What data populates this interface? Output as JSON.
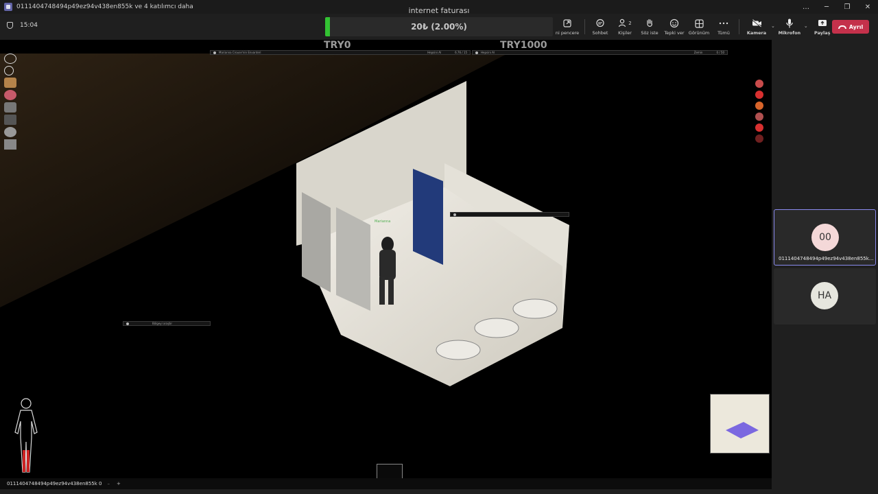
{
  "titlebar": {
    "title": "0111404748494p49ez94v438en855k ve 4 katılımcı daha",
    "controls": [
      "…",
      "─",
      "❐",
      "✕"
    ]
  },
  "stream": {
    "title": "internet faturası",
    "progress_label": "20₺ (2.00%)",
    "progress_fraction": 0.02,
    "left_label": "TRY0",
    "right_label": "TRY1000"
  },
  "meeting": {
    "timer": "15:04",
    "tools": [
      {
        "label": "ni pencere",
        "icon": "popout-icon"
      },
      {
        "label": "Sohbet",
        "icon": "chat-icon"
      },
      {
        "label": "Kişiler",
        "icon": "people-icon",
        "count": "2"
      },
      {
        "label": "Söz iste",
        "icon": "raise-hand-icon"
      },
      {
        "label": "Tepki ver",
        "icon": "emoji-icon"
      },
      {
        "label": "Görünüm",
        "icon": "view-icon"
      },
      {
        "label": "Tümü",
        "icon": "more-icon"
      },
      {
        "label": "Kamera",
        "icon": "camera-off-icon"
      },
      {
        "label": "Mikrofon",
        "icon": "mic-icon"
      },
      {
        "label": "Paylaş",
        "icon": "share-icon"
      }
    ],
    "leave_label": "Ayrıl",
    "leave_color": "#c4314b"
  },
  "game": {
    "inventory_left": {
      "title": "Marianna Crouse'nin Envanteri",
      "action": "Hepsini Al",
      "weight": "6.76 / 15"
    },
    "inventory_right": {
      "title": "Hepsini Al",
      "action": "Zemin",
      "weight": "0 / 50"
    },
    "search_bar": "Bölgeyi araştır",
    "player_name_tag": "Marianna"
  },
  "participants": [
    {
      "initials": "00",
      "name": "0111404748494p49ez94v438en855k...",
      "avatar_bg": "#f4d8d8",
      "active": true
    },
    {
      "initials": "HA",
      "name": "",
      "avatar_bg": "#e6e6de",
      "active": false
    }
  ],
  "bottom_strip": {
    "name": "0111404748494p49ez94v438en855k 0",
    "minus": "–",
    "plus": "+"
  },
  "colors": {
    "accent": "#8b8cf0",
    "progress_fill": "#33c233"
  }
}
